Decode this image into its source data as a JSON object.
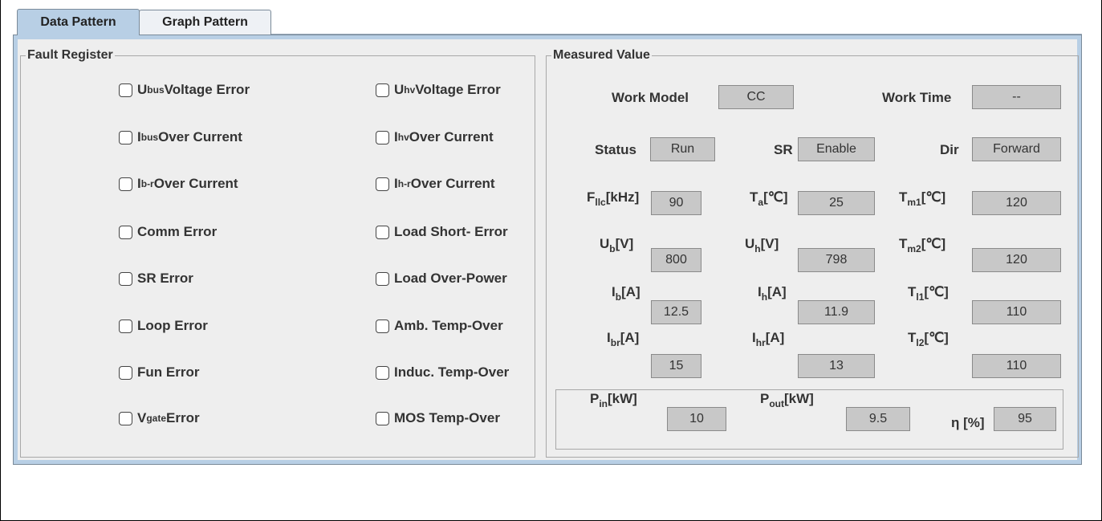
{
  "tabs": [
    {
      "label": "Data Pattern",
      "active": true
    },
    {
      "label": "Graph Pattern",
      "active": false
    }
  ],
  "fault_register": {
    "title": "Fault Register",
    "left": [
      {
        "main": "U",
        "sub": "bus",
        "text": " Voltage Error",
        "checked": false
      },
      {
        "main": "I",
        "sub": "bus",
        "text": " Over Current",
        "checked": false
      },
      {
        "main": "I",
        "sub": "b-r",
        "text": " Over Current",
        "checked": false
      },
      {
        "main": "Comm Error",
        "sub": "",
        "text": "",
        "checked": false
      },
      {
        "main": "SR Error",
        "sub": "",
        "text": "",
        "checked": false
      },
      {
        "main": "Loop Error",
        "sub": "",
        "text": "",
        "checked": false
      },
      {
        "main": "Fun Error",
        "sub": "",
        "text": "",
        "checked": false
      },
      {
        "main": "V",
        "sub": "gate",
        "text": "Error",
        "checked": false
      }
    ],
    "right": [
      {
        "main": "U",
        "sub": "hv",
        "text": " Voltage Error",
        "checked": false
      },
      {
        "main": "I",
        "sub": "hv",
        "text": " Over Current",
        "checked": false
      },
      {
        "main": "I",
        "sub": "h-r",
        "text": " Over Current",
        "checked": false
      },
      {
        "main": "Load Short- Error",
        "sub": "",
        "text": "",
        "checked": false
      },
      {
        "main": "Load Over-Power",
        "sub": "",
        "text": "",
        "checked": false
      },
      {
        "main": "Amb. Temp-Over",
        "sub": "",
        "text": "",
        "checked": false
      },
      {
        "main": "Induc. Temp-Over",
        "sub": "",
        "text": "",
        "checked": false
      },
      {
        "main": "MOS Temp-Over",
        "sub": "",
        "text": "",
        "checked": false
      }
    ]
  },
  "measured": {
    "title": "Measured Value",
    "work_model": {
      "label": "Work Model",
      "value": "CC"
    },
    "work_time": {
      "label": "Work Time",
      "value": "--"
    },
    "status": {
      "label": "Status",
      "value": "Run"
    },
    "sr": {
      "label": "SR",
      "value": "Enable"
    },
    "dir": {
      "label": "Dir",
      "value": "Forward"
    },
    "f_llc": {
      "main": "F",
      "sub": "llc",
      "unit": "[kHz]",
      "value": "90"
    },
    "t_a": {
      "main": "T",
      "sub": "a",
      "unit": "[℃]",
      "value": "25"
    },
    "t_m1": {
      "main": "T",
      "sub": "m1",
      "unit": "[℃]",
      "value": "120"
    },
    "u_b": {
      "main": "U",
      "sub": "b",
      "unit": "[V]",
      "value": "800"
    },
    "u_h": {
      "main": "U",
      "sub": "h",
      "unit": "[V]",
      "value": "798"
    },
    "t_m2": {
      "main": "T",
      "sub": "m2",
      "unit": "[℃]",
      "value": "120"
    },
    "i_b": {
      "main": "I",
      "sub": "b",
      "unit": "[A]",
      "value": "12.5"
    },
    "i_h": {
      "main": "I",
      "sub": "h",
      "unit": "[A]",
      "value": "11.9"
    },
    "t_l1": {
      "main": "T",
      "sub": "l1",
      "unit": "[℃]",
      "value": "110"
    },
    "i_br": {
      "main": "I",
      "sub": "br",
      "unit": "[A]",
      "value": "15"
    },
    "i_hr": {
      "main": "I",
      "sub": "hr",
      "unit": "[A]",
      "value": "13"
    },
    "t_l2": {
      "main": "T",
      "sub": "l2",
      "unit": "[℃]",
      "value": "110"
    },
    "p_in": {
      "main": "P",
      "sub": "in",
      "unit": "[kW]",
      "value": "10"
    },
    "p_out": {
      "main": "P",
      "sub": "out",
      "unit": "[kW]",
      "value": "9.5"
    },
    "eta": {
      "main": "η [%]",
      "sub": "",
      "unit": "",
      "value": "95"
    }
  }
}
